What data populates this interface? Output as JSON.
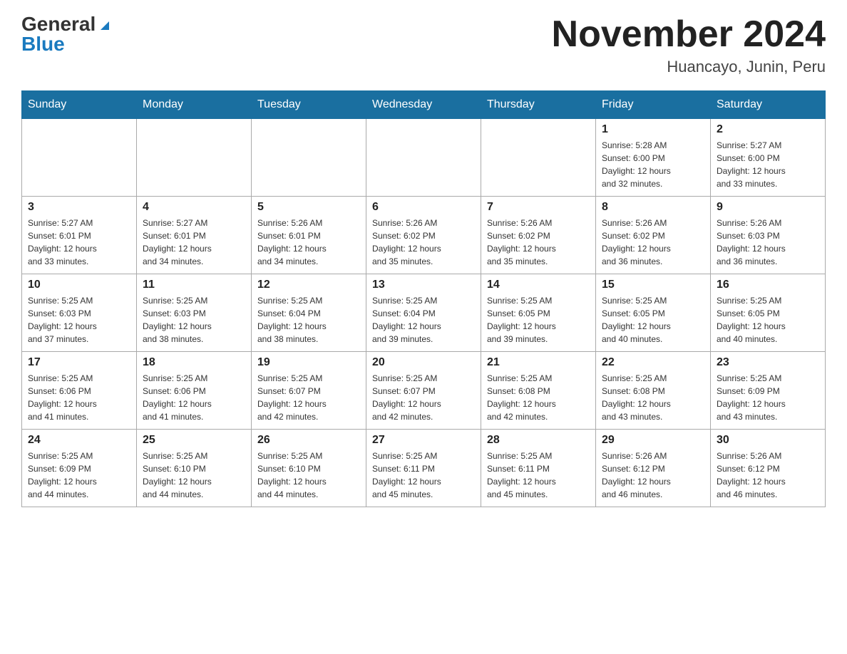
{
  "header": {
    "logo_general": "General",
    "logo_blue": "Blue",
    "title": "November 2024",
    "location": "Huancayo, Junin, Peru"
  },
  "weekdays": [
    "Sunday",
    "Monday",
    "Tuesday",
    "Wednesday",
    "Thursday",
    "Friday",
    "Saturday"
  ],
  "weeks": [
    [
      {
        "day": "",
        "info": ""
      },
      {
        "day": "",
        "info": ""
      },
      {
        "day": "",
        "info": ""
      },
      {
        "day": "",
        "info": ""
      },
      {
        "day": "",
        "info": ""
      },
      {
        "day": "1",
        "info": "Sunrise: 5:28 AM\nSunset: 6:00 PM\nDaylight: 12 hours\nand 32 minutes."
      },
      {
        "day": "2",
        "info": "Sunrise: 5:27 AM\nSunset: 6:00 PM\nDaylight: 12 hours\nand 33 minutes."
      }
    ],
    [
      {
        "day": "3",
        "info": "Sunrise: 5:27 AM\nSunset: 6:01 PM\nDaylight: 12 hours\nand 33 minutes."
      },
      {
        "day": "4",
        "info": "Sunrise: 5:27 AM\nSunset: 6:01 PM\nDaylight: 12 hours\nand 34 minutes."
      },
      {
        "day": "5",
        "info": "Sunrise: 5:26 AM\nSunset: 6:01 PM\nDaylight: 12 hours\nand 34 minutes."
      },
      {
        "day": "6",
        "info": "Sunrise: 5:26 AM\nSunset: 6:02 PM\nDaylight: 12 hours\nand 35 minutes."
      },
      {
        "day": "7",
        "info": "Sunrise: 5:26 AM\nSunset: 6:02 PM\nDaylight: 12 hours\nand 35 minutes."
      },
      {
        "day": "8",
        "info": "Sunrise: 5:26 AM\nSunset: 6:02 PM\nDaylight: 12 hours\nand 36 minutes."
      },
      {
        "day": "9",
        "info": "Sunrise: 5:26 AM\nSunset: 6:03 PM\nDaylight: 12 hours\nand 36 minutes."
      }
    ],
    [
      {
        "day": "10",
        "info": "Sunrise: 5:25 AM\nSunset: 6:03 PM\nDaylight: 12 hours\nand 37 minutes."
      },
      {
        "day": "11",
        "info": "Sunrise: 5:25 AM\nSunset: 6:03 PM\nDaylight: 12 hours\nand 38 minutes."
      },
      {
        "day": "12",
        "info": "Sunrise: 5:25 AM\nSunset: 6:04 PM\nDaylight: 12 hours\nand 38 minutes."
      },
      {
        "day": "13",
        "info": "Sunrise: 5:25 AM\nSunset: 6:04 PM\nDaylight: 12 hours\nand 39 minutes."
      },
      {
        "day": "14",
        "info": "Sunrise: 5:25 AM\nSunset: 6:05 PM\nDaylight: 12 hours\nand 39 minutes."
      },
      {
        "day": "15",
        "info": "Sunrise: 5:25 AM\nSunset: 6:05 PM\nDaylight: 12 hours\nand 40 minutes."
      },
      {
        "day": "16",
        "info": "Sunrise: 5:25 AM\nSunset: 6:05 PM\nDaylight: 12 hours\nand 40 minutes."
      }
    ],
    [
      {
        "day": "17",
        "info": "Sunrise: 5:25 AM\nSunset: 6:06 PM\nDaylight: 12 hours\nand 41 minutes."
      },
      {
        "day": "18",
        "info": "Sunrise: 5:25 AM\nSunset: 6:06 PM\nDaylight: 12 hours\nand 41 minutes."
      },
      {
        "day": "19",
        "info": "Sunrise: 5:25 AM\nSunset: 6:07 PM\nDaylight: 12 hours\nand 42 minutes."
      },
      {
        "day": "20",
        "info": "Sunrise: 5:25 AM\nSunset: 6:07 PM\nDaylight: 12 hours\nand 42 minutes."
      },
      {
        "day": "21",
        "info": "Sunrise: 5:25 AM\nSunset: 6:08 PM\nDaylight: 12 hours\nand 42 minutes."
      },
      {
        "day": "22",
        "info": "Sunrise: 5:25 AM\nSunset: 6:08 PM\nDaylight: 12 hours\nand 43 minutes."
      },
      {
        "day": "23",
        "info": "Sunrise: 5:25 AM\nSunset: 6:09 PM\nDaylight: 12 hours\nand 43 minutes."
      }
    ],
    [
      {
        "day": "24",
        "info": "Sunrise: 5:25 AM\nSunset: 6:09 PM\nDaylight: 12 hours\nand 44 minutes."
      },
      {
        "day": "25",
        "info": "Sunrise: 5:25 AM\nSunset: 6:10 PM\nDaylight: 12 hours\nand 44 minutes."
      },
      {
        "day": "26",
        "info": "Sunrise: 5:25 AM\nSunset: 6:10 PM\nDaylight: 12 hours\nand 44 minutes."
      },
      {
        "day": "27",
        "info": "Sunrise: 5:25 AM\nSunset: 6:11 PM\nDaylight: 12 hours\nand 45 minutes."
      },
      {
        "day": "28",
        "info": "Sunrise: 5:25 AM\nSunset: 6:11 PM\nDaylight: 12 hours\nand 45 minutes."
      },
      {
        "day": "29",
        "info": "Sunrise: 5:26 AM\nSunset: 6:12 PM\nDaylight: 12 hours\nand 46 minutes."
      },
      {
        "day": "30",
        "info": "Sunrise: 5:26 AM\nSunset: 6:12 PM\nDaylight: 12 hours\nand 46 minutes."
      }
    ]
  ]
}
